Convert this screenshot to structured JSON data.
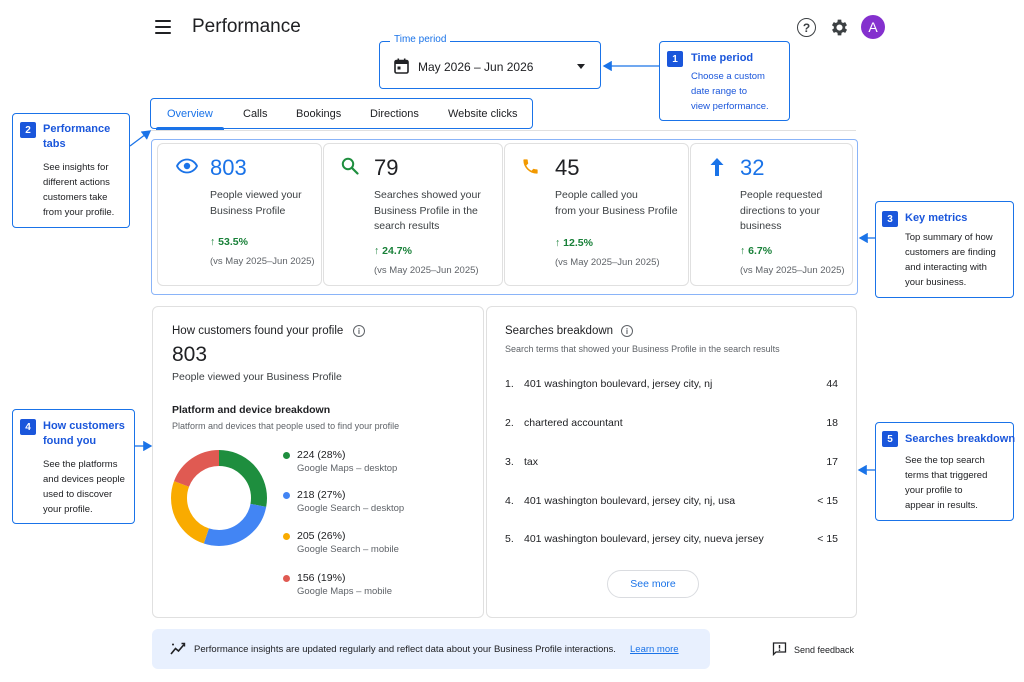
{
  "header": {
    "title": "Performance",
    "avatar_initial": "A"
  },
  "time_period": {
    "legend": "Time period",
    "value": "May 2026 – Jun 2026"
  },
  "tabs": [
    {
      "label": "Overview",
      "active": true
    },
    {
      "label": "Calls",
      "active": false
    },
    {
      "label": "Bookings",
      "active": false
    },
    {
      "label": "Directions",
      "active": false
    },
    {
      "label": "Website clicks",
      "active": false
    }
  ],
  "metrics": [
    {
      "icon": "eye-icon",
      "value": "803",
      "label_lines": [
        "People viewed your",
        "Business Profile"
      ],
      "change": "↑ 53.5%",
      "compare": "(vs May 2025–Jun 2025)"
    },
    {
      "icon": "search-icon",
      "value": "79",
      "label_lines": [
        "Searches showed your",
        "Business Profile in the",
        "search results"
      ],
      "change": "↑ 24.7%",
      "compare": "(vs May 2025–Jun 2025)"
    },
    {
      "icon": "phone-icon",
      "value": "45",
      "label_lines": [
        "People called you",
        "from your Business Profile"
      ],
      "change": "↑ 12.5%",
      "compare": "(vs May 2025–Jun 2025)"
    },
    {
      "icon": "arrow-up-icon",
      "value": "32",
      "label_lines": [
        "People requested",
        "directions to your",
        "business"
      ],
      "change": "↑ 6.7%",
      "compare": "(vs May 2025–Jun 2025)"
    }
  ],
  "found_profile": {
    "title": "How customers found your profile",
    "total": "803",
    "total_label": "People viewed your Business Profile",
    "breakdown_title": "Platform and device breakdown",
    "breakdown_caption": "Platform and devices that people used to find your profile"
  },
  "chart_data": {
    "type": "pie",
    "donut": true,
    "categories": [
      "Google Maps – desktop",
      "Google Search – desktop",
      "Google Search – mobile",
      "Google Maps – mobile"
    ],
    "values": [
      224,
      218,
      205,
      156
    ],
    "percent": [
      28,
      27,
      26,
      19
    ],
    "labels": [
      "224 (28%)",
      "218 (27%)",
      "205 (26%)",
      "156 (19%)"
    ],
    "colors": [
      "#1e8e3e",
      "#4285f4",
      "#f9ab00",
      "#e05a52"
    ]
  },
  "searches": {
    "title": "Searches breakdown",
    "caption": "Search terms that showed your Business Profile in the search results",
    "items": [
      {
        "rank": "1.",
        "term": "401 washington boulevard, jersey city, nj",
        "count": "44"
      },
      {
        "rank": "2.",
        "term": "chartered accountant",
        "count": "18"
      },
      {
        "rank": "3.",
        "term": "tax",
        "count": "17"
      },
      {
        "rank": "4.",
        "term": "401 washington boulevard, jersey city, nj, usa",
        "count": "< 15"
      },
      {
        "rank": "5.",
        "term": "401 washington boulevard, jersey city, nueva jersey",
        "count": "< 15"
      }
    ],
    "see_more": "See more"
  },
  "footer": {
    "text": "Performance insights are updated regularly and reflect data about your Business Profile interactions.",
    "learn_more": "Learn more",
    "feedback": "Send feedback"
  },
  "callouts": [
    {
      "num": "1",
      "title_lines": [
        "Time period"
      ],
      "text_lines": [
        "Choose a custom",
        "date range to",
        "view performance."
      ],
      "text_blue": true
    },
    {
      "num": "2",
      "title_lines": [
        "Performance",
        "tabs"
      ],
      "text_lines": [
        "See insights for",
        "different actions",
        "customers take",
        "from your profile."
      ],
      "text_blue": false
    },
    {
      "num": "3",
      "title_lines": [
        "Key metrics"
      ],
      "text_lines": [
        "Top summary of how",
        "customers are finding",
        "and interacting with",
        "your business."
      ],
      "text_blue": false
    },
    {
      "num": "4",
      "title_lines": [
        "How customers",
        "found you"
      ],
      "text_lines": [
        "See the platforms",
        "and devices people",
        "used to discover",
        "your profile."
      ],
      "text_blue": false
    },
    {
      "num": "5",
      "title_lines": [
        "Searches breakdown"
      ],
      "text_lines": [
        "See the top search",
        "terms that triggered",
        "your profile to",
        "appear in results."
      ],
      "text_blue": false
    }
  ],
  "colors": {
    "accent": "#1a73e8",
    "positive": "#188038",
    "callout_badge": "#1a56db"
  }
}
